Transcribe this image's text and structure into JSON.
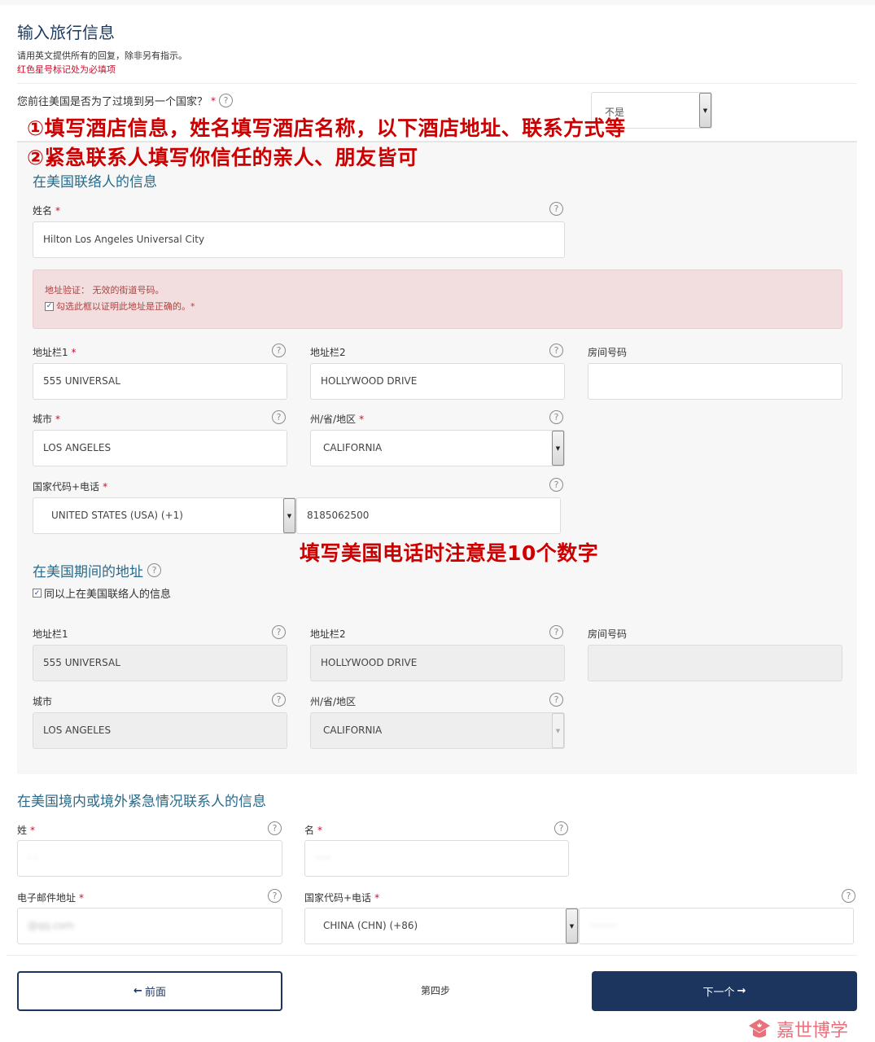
{
  "page": {
    "title": "输入旅行信息",
    "subtitle": "请用英文提供所有的回复，除非另有指示。",
    "required_note": "红色星号标记处为必填项"
  },
  "transit": {
    "question": "您前往美国是否为了过境到另一个国家？",
    "required_mark": "*",
    "help_glyph": "?",
    "selected": "不是"
  },
  "annotations": {
    "note1": "①填写酒店信息，姓名填写酒店名称，以下酒店地址、联系方式等",
    "note2": "②紧急联系人填写你信任的亲人、朋友皆可",
    "note3": "填写美国电话时注意是10个数字",
    "color": "#cc0000"
  },
  "us_contact": {
    "heading": "在美国联络人的信息",
    "name_label": "姓名",
    "name_value": "Hilton Los Angeles Universal City",
    "alert_line1": "地址验证： 无效的街道号码。",
    "alert_line2": "勾选此框以证明此地址是正确的。*",
    "alert_checked": true,
    "address1_label": "地址栏1",
    "address1_value": "555 UNIVERSAL",
    "address2_label": "地址栏2",
    "address2_value": "HOLLYWOOD DRIVE",
    "room_label": "房间号码",
    "room_value": "",
    "city_label": "城市",
    "city_value": "LOS ANGELES",
    "state_label": "州/省/地区",
    "state_value": "CALIFORNIA",
    "phone_label": "国家代码+电话",
    "country_code_value": "UNITED STATES (USA) (+1)",
    "phone_value": "8185062500"
  },
  "us_address": {
    "heading": "在美国期间的地址",
    "same_as_label": "同以上在美国联络人的信息",
    "same_as_checked": true,
    "address1_label": "地址栏1",
    "address1_value": "555 UNIVERSAL",
    "address2_label": "地址栏2",
    "address2_value": "HOLLYWOOD DRIVE",
    "room_label": "房间号码",
    "room_value": "",
    "city_label": "城市",
    "city_value": "LOS ANGELES",
    "state_label": "州/省/地区",
    "state_value": "CALIFORNIA"
  },
  "emergency": {
    "heading": "在美国境内或境外紧急情况联系人的信息",
    "surname_label": "姓",
    "given_label": "名",
    "email_label": "电子邮件地址",
    "email_value_visible": "@qq.com",
    "phone_label": "国家代码+电话",
    "country_code_value": "CHINA (CHN) (+86)"
  },
  "nav": {
    "prev_label": "前面",
    "prev_icon": "←",
    "step_label": "第四步",
    "next_label": "下一个",
    "next_icon": "→"
  },
  "watermark": {
    "text": "嘉世博学"
  }
}
